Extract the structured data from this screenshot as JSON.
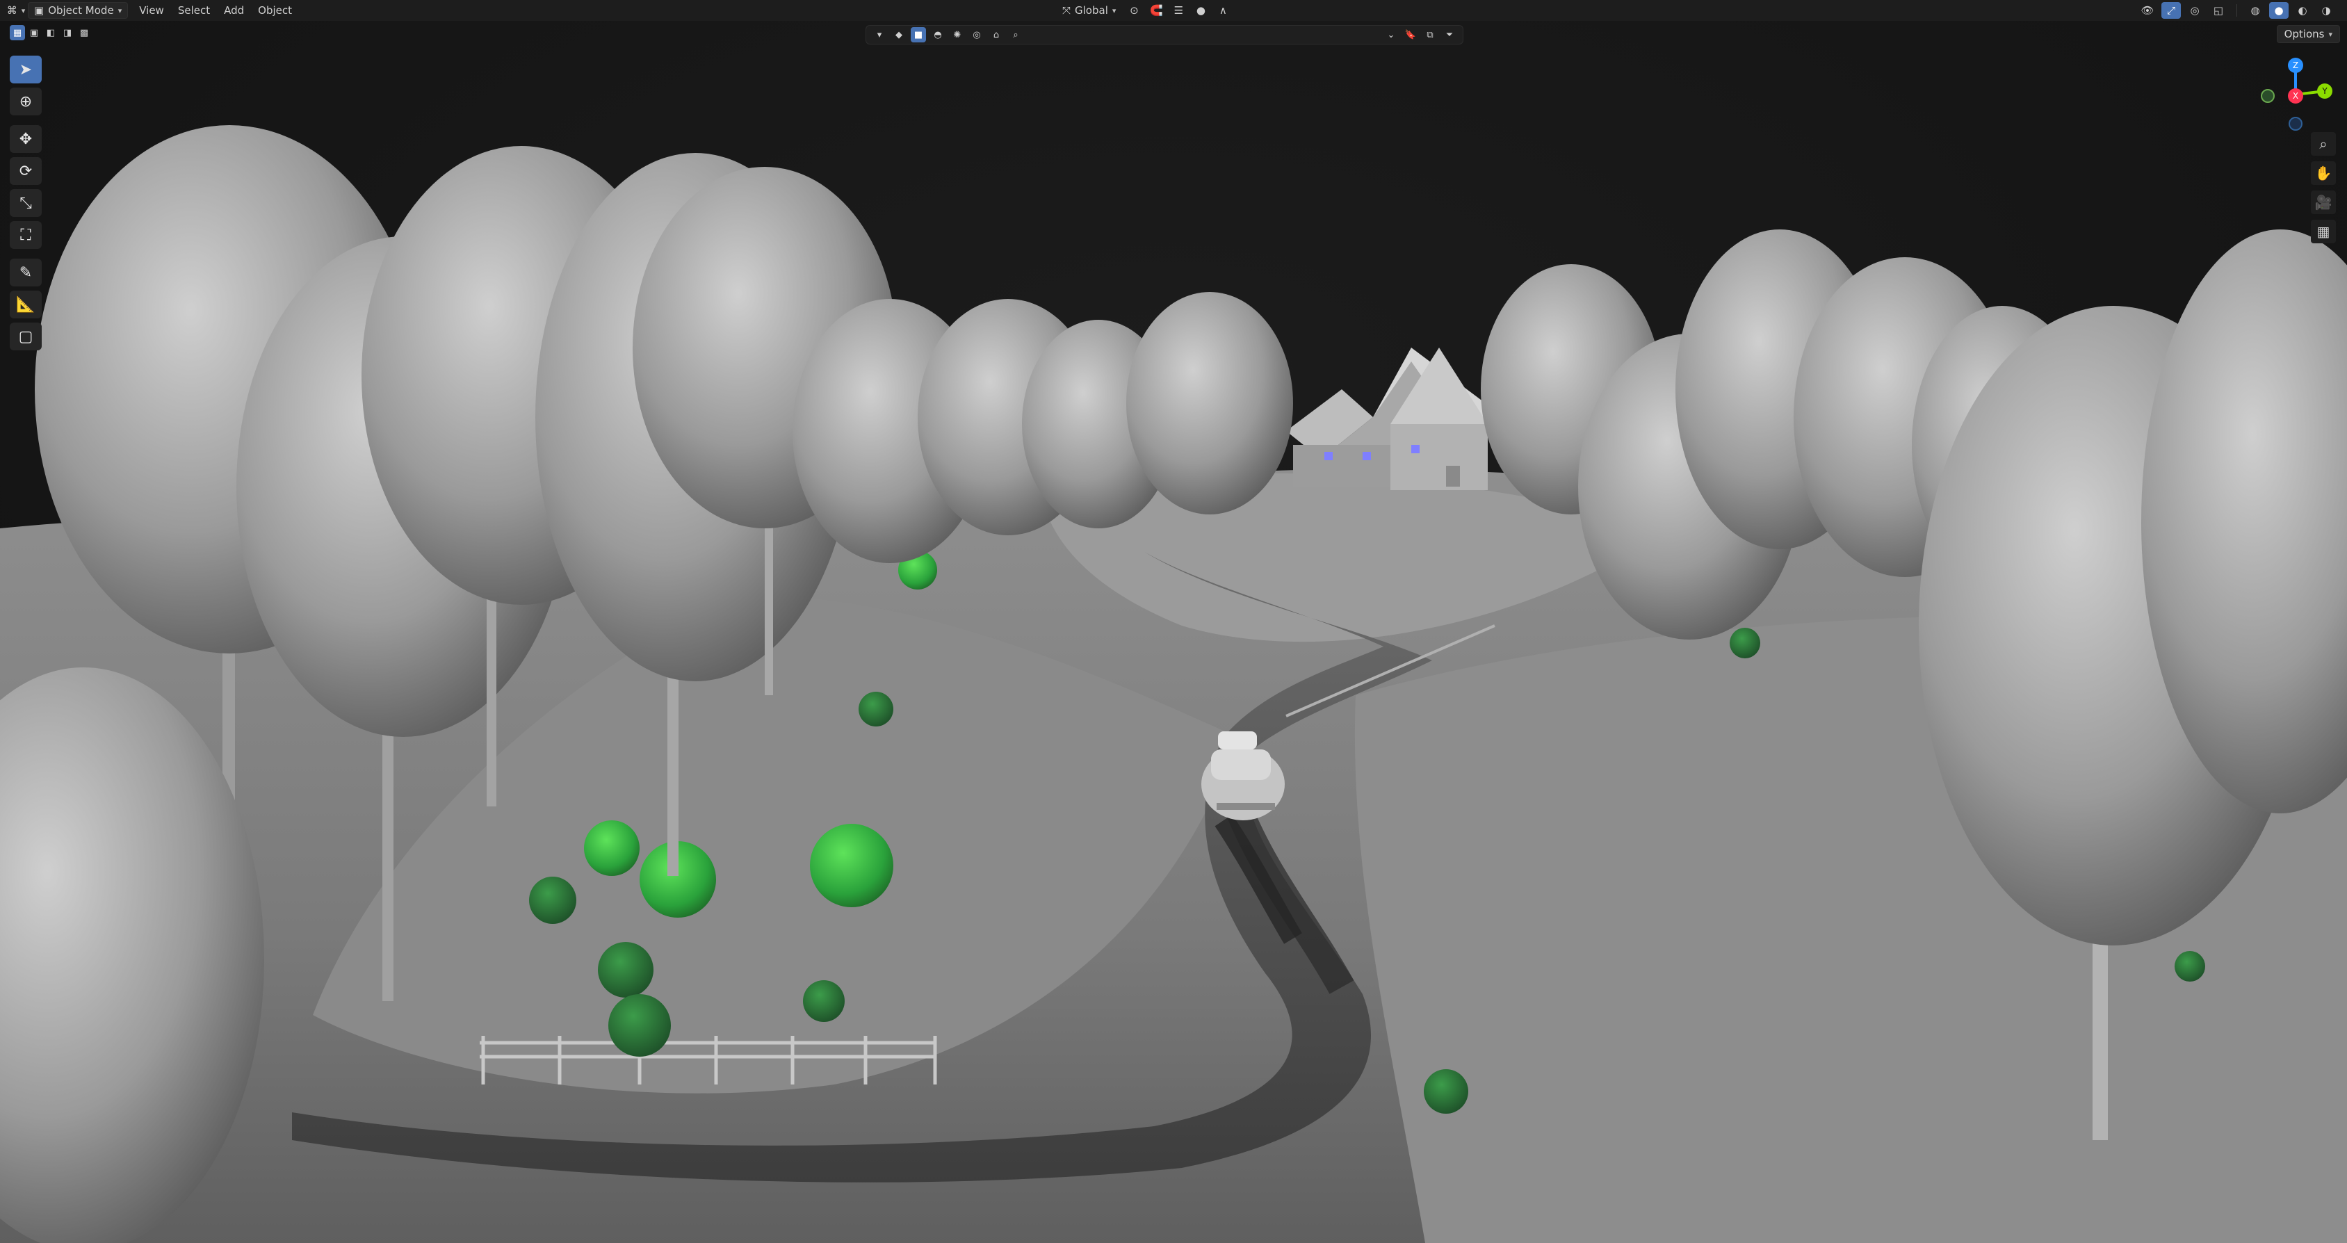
{
  "header": {
    "mode": "Object Mode",
    "menus": [
      "View",
      "Select",
      "Add",
      "Object"
    ],
    "transform_orientation": "Global"
  },
  "toolbar": {
    "options_label": "Options"
  },
  "gizmo": {
    "axes": [
      "X",
      "Y",
      "Z"
    ]
  },
  "colors": {
    "accent": "#4772b3",
    "x_axis": "#ff3352",
    "y_axis": "#8bdc00",
    "z_axis": "#2890ff"
  }
}
